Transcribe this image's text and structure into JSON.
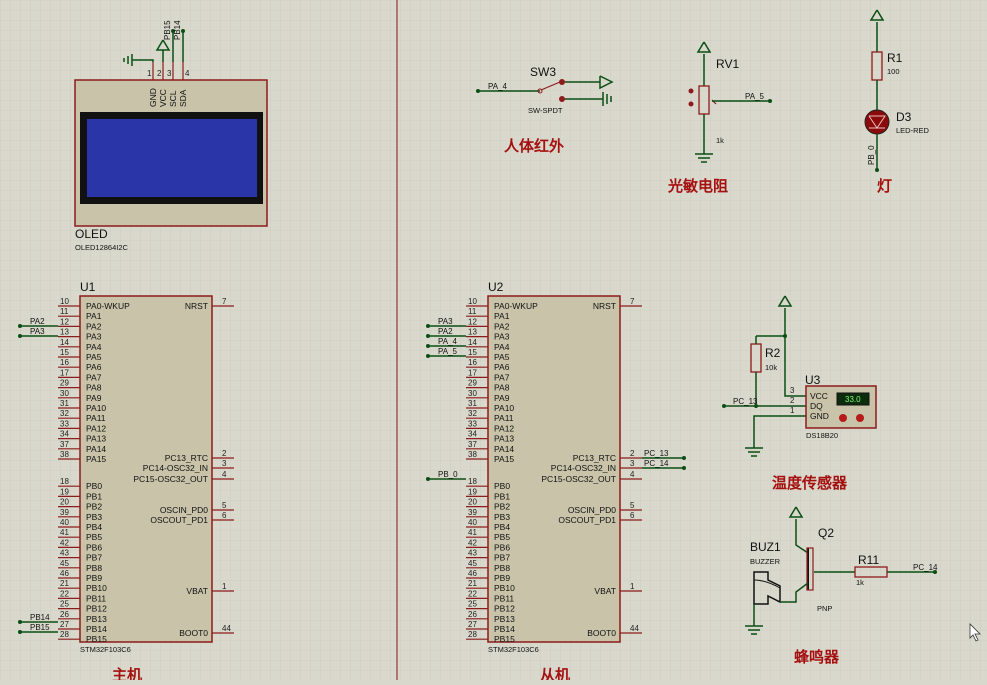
{
  "labels": {
    "human_ir": "人体红外",
    "ldr": "光敏电阻",
    "lamp": "灯",
    "temp_sensor": "温度传感器",
    "buzzer_zh": "蜂鸣器",
    "master": "主机",
    "slave": "从机"
  },
  "oled": {
    "ref": "OLED",
    "part": "OLED12864I2C",
    "pins": [
      "GND",
      "VCC",
      "SCL",
      "SDA"
    ],
    "pin_nums": [
      "1",
      "2",
      "3",
      "4"
    ],
    "net_labels": [
      "PB15",
      "PB14"
    ]
  },
  "sw3": {
    "ref": "SW3",
    "part": "SW-SPDT",
    "net": "PA_4"
  },
  "rv1": {
    "ref": "RV1",
    "value": "1k",
    "net": "PA_5"
  },
  "r1": {
    "ref": "R1",
    "value": "100"
  },
  "d3": {
    "ref": "D3",
    "part": "LED-RED",
    "net": "PB_0"
  },
  "u1": {
    "ref": "U1",
    "part": "STM32F103C6",
    "left_pins": [
      {
        "num": "10",
        "name": "PA0-WKUP"
      },
      {
        "num": "11",
        "name": "PA1"
      },
      {
        "num": "12",
        "name": "PA2"
      },
      {
        "num": "13",
        "name": "PA3"
      },
      {
        "num": "14",
        "name": "PA4"
      },
      {
        "num": "15",
        "name": "PA5"
      },
      {
        "num": "16",
        "name": "PA6"
      },
      {
        "num": "17",
        "name": "PA7"
      },
      {
        "num": "29",
        "name": "PA8"
      },
      {
        "num": "30",
        "name": "PA9"
      },
      {
        "num": "31",
        "name": "PA10"
      },
      {
        "num": "32",
        "name": "PA11"
      },
      {
        "num": "33",
        "name": "PA12"
      },
      {
        "num": "34",
        "name": "PA13"
      },
      {
        "num": "37",
        "name": "PA14"
      },
      {
        "num": "38",
        "name": "PA15"
      },
      {
        "num": "18",
        "name": "PB0"
      },
      {
        "num": "19",
        "name": "PB1"
      },
      {
        "num": "20",
        "name": "PB2"
      },
      {
        "num": "39",
        "name": "PB3"
      },
      {
        "num": "40",
        "name": "PB4"
      },
      {
        "num": "41",
        "name": "PB5"
      },
      {
        "num": "42",
        "name": "PB6"
      },
      {
        "num": "43",
        "name": "PB7"
      },
      {
        "num": "45",
        "name": "PB8"
      },
      {
        "num": "46",
        "name": "PB9"
      },
      {
        "num": "21",
        "name": "PB10"
      },
      {
        "num": "22",
        "name": "PB11"
      },
      {
        "num": "25",
        "name": "PB12"
      },
      {
        "num": "26",
        "name": "PB13"
      },
      {
        "num": "27",
        "name": "PB14"
      },
      {
        "num": "28",
        "name": "PB15"
      }
    ],
    "right_pins": [
      {
        "num": "7",
        "name": "NRST"
      },
      {
        "num": "2",
        "name": "PC13_RTC"
      },
      {
        "num": "3",
        "name": "PC14-OSC32_IN"
      },
      {
        "num": "4",
        "name": "PC15-OSC32_OUT"
      },
      {
        "num": "5",
        "name": "OSCIN_PD0"
      },
      {
        "num": "6",
        "name": "OSCOUT_PD1"
      },
      {
        "num": "1",
        "name": "VBAT"
      },
      {
        "num": "44",
        "name": "BOOT0"
      }
    ],
    "nets": [
      "PA2",
      "PA3",
      "PB14",
      "PB15"
    ]
  },
  "u2": {
    "ref": "U2",
    "part": "STM32F103C6",
    "nets": [
      "PA3",
      "PA2",
      "PA_4",
      "PA_5",
      "PB_0",
      "PC_13",
      "PC_14"
    ]
  },
  "r2": {
    "ref": "R2",
    "value": "10k"
  },
  "u3": {
    "ref": "U3",
    "part": "DS18B20",
    "pins": [
      "VCC",
      "DQ",
      "GND"
    ],
    "pin_nums": [
      "3",
      "2",
      "1"
    ],
    "display": "33.0",
    "net": "PC_13"
  },
  "buz1": {
    "ref": "BUZ1",
    "part": "BUZZER"
  },
  "q2": {
    "ref": "Q2",
    "part": "PNP"
  },
  "r11": {
    "ref": "R11",
    "value": "1k",
    "net": "PC_14"
  },
  "colors": {
    "background": "#d9d8cc",
    "grid": "#c6c5b8",
    "device_fill": "#c8c3a9",
    "device_border": "#8e1b1b",
    "wire": "#0b4f14",
    "label_red": "#a51010",
    "oled_screen": "#2a35a8"
  }
}
